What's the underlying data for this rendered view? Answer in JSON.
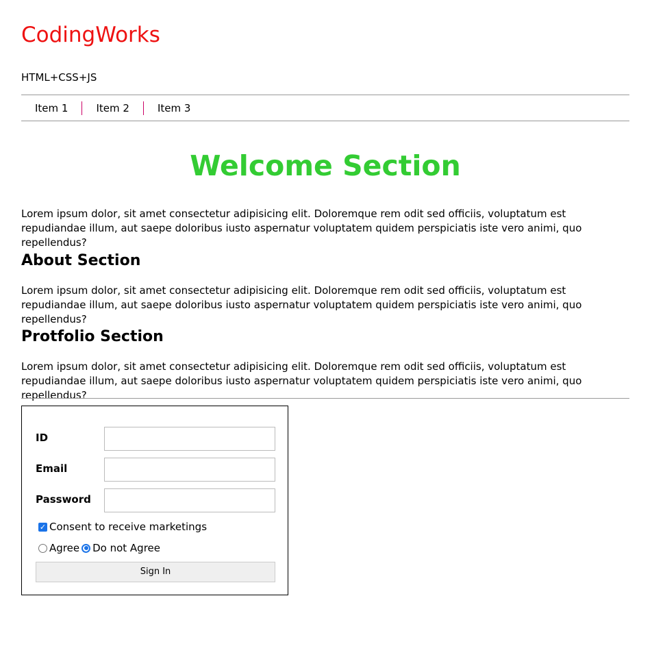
{
  "header": {
    "brand": "CodingWorks",
    "tagline": "HTML+CSS+JS"
  },
  "nav": {
    "items": [
      "Item 1",
      "Item 2",
      "Item 3"
    ]
  },
  "welcome": {
    "title": "Welcome Section",
    "text": "Lorem ipsum dolor, sit amet consectetur adipisicing elit. Doloremque rem odit sed officiis, voluptatum est repudiandae illum, aut saepe doloribus iusto aspernatur voluptatem quidem perspiciatis iste vero animi, quo repellendus?"
  },
  "about": {
    "title": "About Section",
    "text": "Lorem ipsum dolor, sit amet consectetur adipisicing elit. Doloremque rem odit sed officiis, voluptatum est repudiandae illum, aut saepe doloribus iusto aspernatur voluptatem quidem perspiciatis iste vero animi, quo repellendus?"
  },
  "portfolio": {
    "title": "Protfolio Section",
    "text": "Lorem ipsum dolor, sit amet consectetur adipisicing elit. Doloremque rem odit sed officiis, voluptatum est repudiandae illum, aut saepe doloribus iusto aspernatur voluptatem quidem perspiciatis iste vero animi, quo repellendus?"
  },
  "form": {
    "id_label": "ID",
    "id_value": "",
    "email_label": "Email",
    "email_value": "",
    "password_label": "Password",
    "password_value": "",
    "consent_label": "Consent to receive marketings",
    "consent_checked": true,
    "radio_agree": "Agree",
    "radio_disagree": "Do not Agree",
    "radio_selected": "Do not Agree",
    "submit_label": "Sign In"
  },
  "colors": {
    "brand": "#ee1111",
    "welcome_title": "#33cc33",
    "nav_separator": "#cc0066",
    "accent": "#1a73e8"
  },
  "icons": {
    "consent_checkbox": "check-icon"
  }
}
